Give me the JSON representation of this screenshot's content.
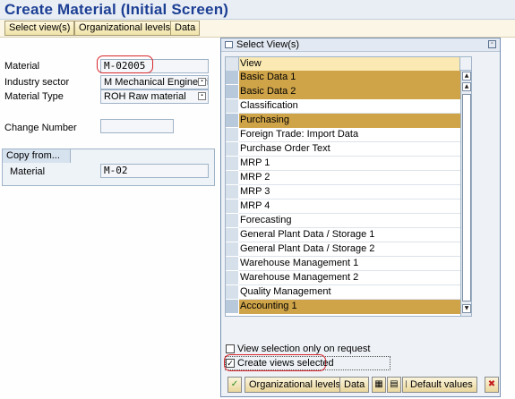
{
  "header": {
    "title": "Create Material (Initial Screen)"
  },
  "toolbar": {
    "buttons": [
      "Select view(s)",
      "Organizational levels",
      "Data"
    ]
  },
  "form": {
    "material_label": "Material",
    "material_value": "M-02005",
    "industry_label": "Industry sector",
    "industry_value": "M Mechanical Engineeri",
    "type_label": "Material Type",
    "type_value": "ROH Raw material",
    "change_label": "Change Number",
    "change_value": ""
  },
  "copy_from": {
    "title": "Copy from...",
    "material_label": "Material",
    "material_value": "M-02"
  },
  "dialog": {
    "title": "Select View(s)",
    "column_header": "View",
    "rows": [
      {
        "label": "Basic Data 1",
        "selected": true
      },
      {
        "label": "Basic Data 2",
        "selected": true
      },
      {
        "label": "Classification",
        "selected": false
      },
      {
        "label": "Purchasing",
        "selected": true
      },
      {
        "label": "Foreign Trade: Import Data",
        "selected": false
      },
      {
        "label": "Purchase Order Text",
        "selected": false
      },
      {
        "label": "MRP 1",
        "selected": false
      },
      {
        "label": "MRP 2",
        "selected": false
      },
      {
        "label": "MRP 3",
        "selected": false
      },
      {
        "label": "MRP 4",
        "selected": false
      },
      {
        "label": "Forecasting",
        "selected": false
      },
      {
        "label": "General Plant Data / Storage 1",
        "selected": false
      },
      {
        "label": "General Plant Data / Storage 2",
        "selected": false
      },
      {
        "label": "Warehouse Management 1",
        "selected": false
      },
      {
        "label": "Warehouse Management 2",
        "selected": false
      },
      {
        "label": "Quality Management",
        "selected": false
      },
      {
        "label": "Accounting 1",
        "selected": true
      }
    ],
    "view_selection_label": "View selection only on request",
    "view_selection_checked": false,
    "create_views_label": "Create views selected",
    "create_views_checked": true,
    "footer": {
      "ok_icon": "check-icon",
      "org_levels": "Organizational levels",
      "data": "Data",
      "select_all_icon": "select-all-icon",
      "deselect_all_icon": "deselect-all-icon",
      "save_icon": "save-icon",
      "default_values": "Default values",
      "cancel_icon": "cancel-icon"
    }
  },
  "colors": {
    "title": "#1c3f94",
    "selected_row": "#cfa449",
    "highlight_ring": "#d9282e"
  }
}
